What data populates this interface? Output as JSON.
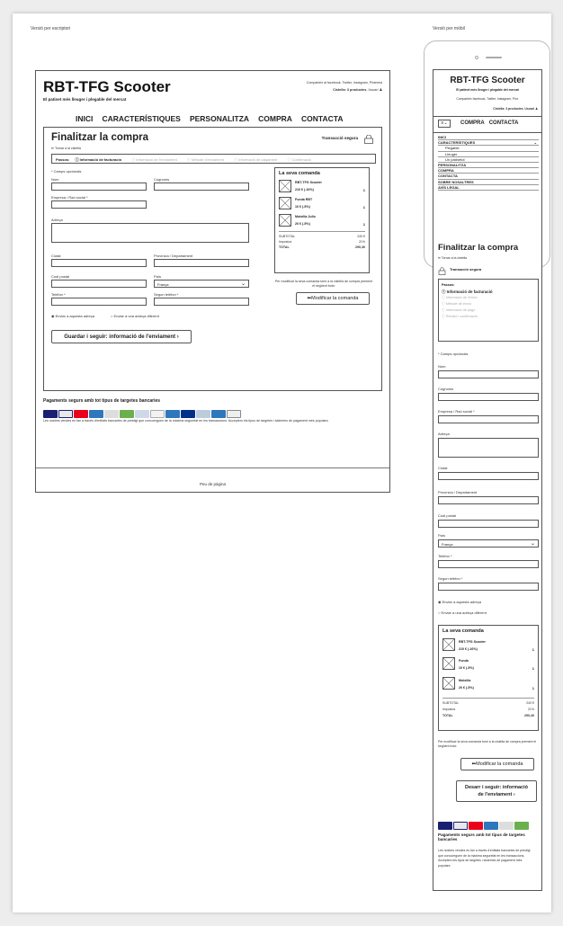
{
  "captions": {
    "desktop": "Versió per escriptori",
    "mobile": "Versió per mòbil"
  },
  "brand": {
    "title": "RBT-TFG Scooter",
    "tagline": "El patinet més lleuger i plegable del mercat"
  },
  "header": {
    "share": "Comparteix al facebook, Twitter, Instagram, Pinterest",
    "cart": "Cistella: 3 productes",
    "user": "Usuari"
  },
  "nav": [
    "INICI",
    "CARACTERÍSTIQUES",
    "PERSONALITZA",
    "COMPRA",
    "CONTACTA"
  ],
  "checkout": {
    "title": "Finalitzar la compra",
    "secure": "Transacció segura",
    "back": "Tornar a la cistella",
    "steps_label": "Passos:",
    "steps": [
      "Informació de facturació",
      "Informació de l'enviament",
      "Mètode d'enviament",
      "Informació de pagament",
      "Confirmació"
    ],
    "required": "* Camps opcionals",
    "fields": {
      "nom": "Nom",
      "cognoms": "Cognoms",
      "empresa": "Empresa / Raó social *",
      "adreca": "Adreça",
      "ciutat": "Ciutat",
      "provincia": "Província / Departament",
      "cp": "Codi postal",
      "pais": "País",
      "telefon": "Telèfon *",
      "telefon2": "Segon telèfon *",
      "pais_value": "França"
    },
    "radio1": "Enviar a aquesta adreça",
    "radio2": "Enviar a una adreça diferent",
    "save_button": "Guardar i seguir: informació de l'enviament ›"
  },
  "order": {
    "title": "La seva comanda",
    "items": [
      {
        "name": "RBT-TFG Scooter",
        "price": "210 € (-16%)",
        "qty": "1"
      },
      {
        "name": "Funda RBT",
        "price": "10 € (-5%)",
        "qty": "1"
      },
      {
        "name": "Motxilla Jullo",
        "price": "20 € (-5%)",
        "qty": "1"
      }
    ],
    "subtotal_label": "SUBTOTAL",
    "subtotal": "240 €",
    "tax_label": "Impostos",
    "tax": "21%",
    "total_label": "TOTAL",
    "total": "290,40",
    "modify_note": "Per modificar la seva comanda torni a la cistella de compra prement el següent botó:",
    "modify_button": "Modificar la comanda"
  },
  "payments": {
    "title": "Pagaments segurs amb tot tipus de targetes bancaries",
    "text": "Les nostres vendes es fan a través d'entitats bancaries de prestigi que concuerguen de la màxima seguretat en les transaccions. Acceptem els tipus de targetes i sistemes de pagament més populars."
  },
  "footer": "Peu de pàgina",
  "mobile": {
    "brand": "RBT-TFG Scooter",
    "tagline": "El patinet més lleuger i plegable del mercat",
    "share": "Comparteix facebook, Twitter, Instagram, Pint.",
    "cart": "Cistella: 3 productes. Usuari",
    "nav": [
      "COMPRA",
      "CONTACTA"
    ],
    "menu": [
      "INICI",
      "CARACTERÍSTIQUES",
      "Plegable",
      "Lleuger",
      "Un patinetot",
      "PERSONALITZA",
      "COMPRA",
      "CONTACTA",
      "SOBRE NOSALTRES",
      "AVÍS LEGAL"
    ],
    "title": "Finalitzar la compra",
    "back": "Tornar a la cistella",
    "secure": "Transacció segura",
    "steps_label": "Passos:",
    "step_active": "Informació de facturació",
    "steps_grey": [
      "Informació de l'envio",
      "Mètode de envio",
      "Informació de pagó",
      "Revisió i confirmació"
    ],
    "required": "* Camps opcionals",
    "fields": [
      "Nom",
      "Cognoms",
      "Empresa / Raó social *",
      "Adreça",
      "Ciutat",
      "Província / Departament",
      "Codi postal",
      "País",
      "Telèfon *",
      "Segon telèfon *"
    ],
    "pais_value": "França",
    "radio1": "Enviar a aquesta adreça",
    "radio2": "Enviar a una adreça diferent",
    "order_title": "La seva comanda",
    "items": [
      {
        "name": "RBT-TFG Scooter",
        "price": "210 € (-16%)",
        "qty": "1"
      },
      {
        "name": "Funda",
        "price": "10 € (-5%)",
        "qty": "1"
      },
      {
        "name": "Motxilla",
        "price": "20 € (-5%)",
        "qty": "1"
      }
    ],
    "subtotal": "240 €",
    "tax": "21%",
    "total": "290,40",
    "modify_note": "Per modificar la seva comanda torni a la cistella de compra prement el següent botó:",
    "modify_button": "Modificar la comanda",
    "save_button": "Desarr i seguir: informació de l'enviament ›",
    "pay_title": "Pagaments segurs amb tot tipus de targetes bancaries",
    "pay_text": "Les nostres vendes es fan a través d'entitats bancaries de prestigi que concuerguen de la màxima seguretat en les transaccions. Acceptem els tipus de targetes i sistemes de pagament més populars."
  },
  "colors": {
    "mastercard": "#eb001b",
    "visa": "#1a1f71",
    "amex": "#2e77bc",
    "paypal": "#003087",
    "green": "#6ab04c"
  }
}
